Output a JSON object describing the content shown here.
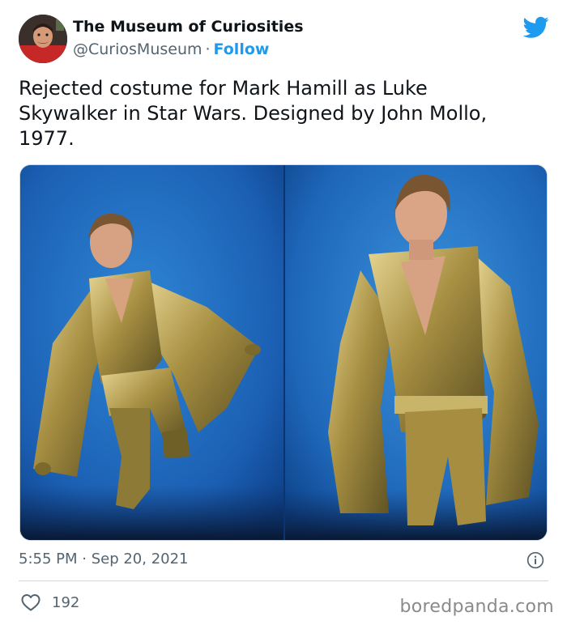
{
  "tweet": {
    "author": {
      "display_name": "The Museum of Curiosities",
      "handle": "@CuriosMuseum",
      "separator": "·",
      "follow_label": "Follow"
    },
    "text": "Rejected costume for Mark Hamill as Luke\nSkywalker in Star Wars. Designed by John Mollo,\n1977.",
    "timestamp": "5:55 PM · Sep 20, 2021",
    "like_count": "192",
    "icons": {
      "brand": "twitter-bird-icon",
      "info": "info-icon",
      "like": "heart-icon"
    },
    "colors": {
      "accent": "#1d9bf0",
      "secondary_text": "#536471",
      "photo_background": "#1e62b6",
      "costume_gold": "#b49a48"
    }
  },
  "watermark": "boredpanda.com"
}
